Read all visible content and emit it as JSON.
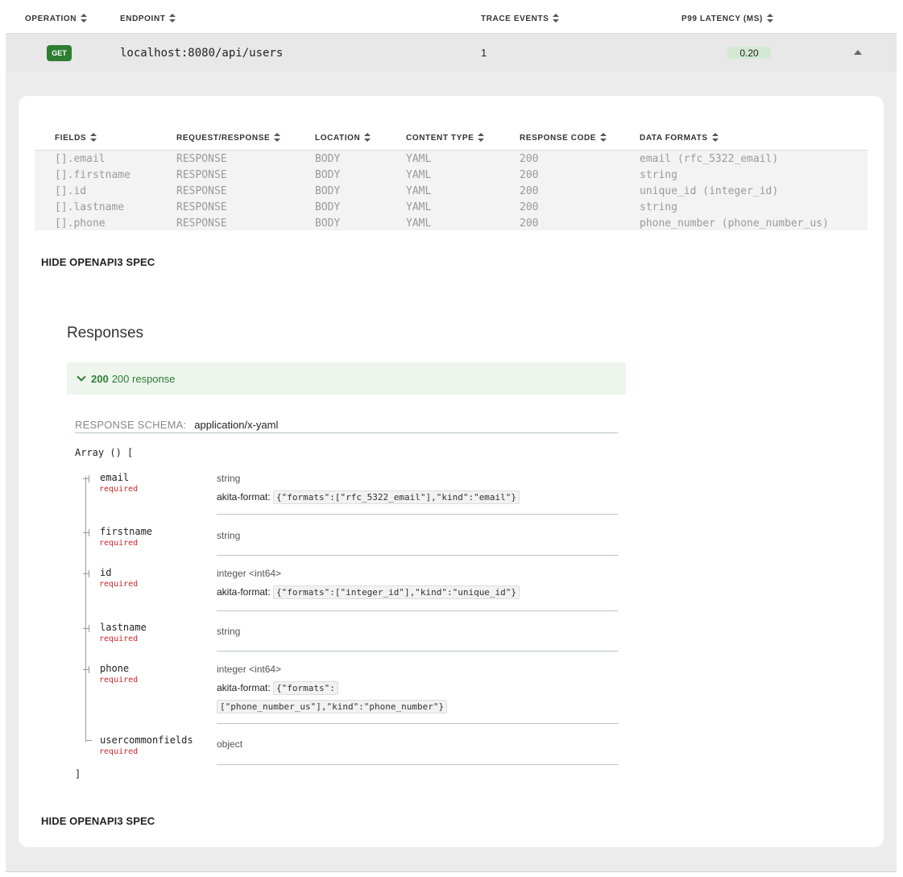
{
  "endpoints_table": {
    "headers": {
      "operation": "OPERATION",
      "endpoint": "ENDPOINT",
      "trace_events": "TRACE EVENTS",
      "p99_latency": "P99 LATENCY (MS)"
    },
    "row": {
      "method": "GET",
      "endpoint": "localhost:8080/api/users",
      "trace_events": "1",
      "p99_latency": "0.20"
    }
  },
  "fields_table": {
    "headers": [
      "FIELDS",
      "REQUEST/RESPONSE",
      "LOCATION",
      "CONTENT TYPE",
      "RESPONSE CODE",
      "DATA FORMATS"
    ],
    "rows": [
      [
        "[].email",
        "RESPONSE",
        "BODY",
        "YAML",
        "200",
        "email (rfc_5322_email)"
      ],
      [
        "[].firstname",
        "RESPONSE",
        "BODY",
        "YAML",
        "200",
        "string"
      ],
      [
        "[].id",
        "RESPONSE",
        "BODY",
        "YAML",
        "200",
        "unique_id (integer_id)"
      ],
      [
        "[].lastname",
        "RESPONSE",
        "BODY",
        "YAML",
        "200",
        "string"
      ],
      [
        "[].phone",
        "RESPONSE",
        "BODY",
        "YAML",
        "200",
        "phone_number (phone_number_us)"
      ]
    ]
  },
  "hide_spec_label": "HIDE OPENAPI3 SPEC",
  "spec": {
    "responses_title": "Responses",
    "response_code": "200",
    "response_desc": "200 response",
    "schema_label": "RESPONSE SCHEMA:",
    "schema_type": "application/x-yaml",
    "array_open": "Array () [",
    "array_close": "]",
    "required_label": "required",
    "format_label": "akita-format:",
    "properties": [
      {
        "name": "email",
        "type": "string",
        "format": "{\"formats\":[\"rfc_5322_email\"],\"kind\":\"email\"}"
      },
      {
        "name": "firstname",
        "type": "string",
        "format": ""
      },
      {
        "name": "id",
        "type": "integer <int64>",
        "format": "{\"formats\":[\"integer_id\"],\"kind\":\"unique_id\"}"
      },
      {
        "name": "lastname",
        "type": "string",
        "format": ""
      },
      {
        "name": "phone",
        "type": "integer <int64>",
        "format_part1": "{\"formats\":",
        "format_part2": "[\"phone_number_us\"],\"kind\":\"phone_number\"}"
      },
      {
        "name": "usercommonfields",
        "type": "object",
        "format": ""
      }
    ]
  }
}
